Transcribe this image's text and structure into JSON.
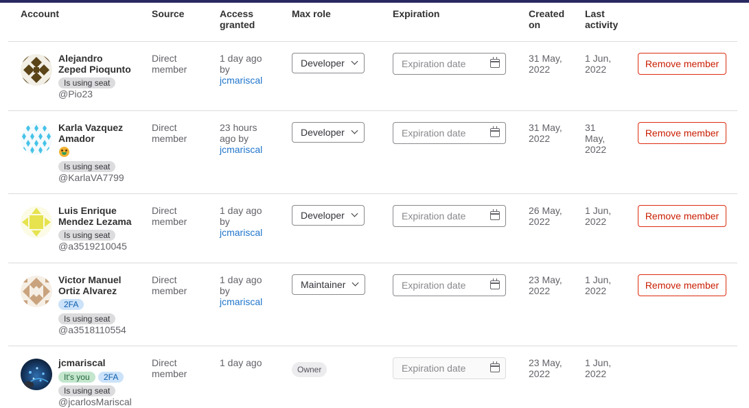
{
  "headers": {
    "account": "Account",
    "source": "Source",
    "access_line1": "Access",
    "access_line2": "granted",
    "max_role": "Max role",
    "expiration": "Expiration",
    "created_line1": "Created",
    "created_line2": "on",
    "activity_line1": "Last",
    "activity_line2": "activity"
  },
  "members": [
    {
      "name_line1": "Alejandro",
      "name_line2": "Zeped Pioqunto",
      "seat_badge": "Is using seat",
      "username": "@Pio23",
      "source_line1": "Direct",
      "source_line2": "member",
      "access_line1": "1 day ago",
      "access_line2": "by",
      "access_by": "jcmariscal",
      "role": "Developer",
      "expiration_placeholder": "Expiration date",
      "created_line1": "31 May,",
      "created_line2": "2022",
      "activity_line1": "1 Jun,",
      "activity_line2": "2022",
      "remove_label": "Remove member"
    },
    {
      "name_line1": "Karla Vazquez",
      "name_line2": "Amador",
      "seat_badge": "Is using seat",
      "username": "@KarlaVA7799",
      "source_line1": "Direct",
      "source_line2": "member",
      "access_line1": "23 hours",
      "access_line2": "ago by",
      "access_by": "jcmariscal",
      "role": "Developer",
      "expiration_placeholder": "Expiration date",
      "created_line1": "31 May,",
      "created_line2": "2022",
      "activity_line1": "31",
      "activity_line2": "May,",
      "activity_line3": "2022",
      "remove_label": "Remove member"
    },
    {
      "name_line1": "Luis Enrique",
      "name_line2": "Mendez Lezama",
      "seat_badge": "Is using seat",
      "username": "@a3519210045",
      "source_line1": "Direct",
      "source_line2": "member",
      "access_line1": "1 day ago",
      "access_line2": "by",
      "access_by": "jcmariscal",
      "role": "Developer",
      "expiration_placeholder": "Expiration date",
      "created_line1": "26 May,",
      "created_line2": "2022",
      "activity_line1": "1 Jun,",
      "activity_line2": "2022",
      "remove_label": "Remove member"
    },
    {
      "name_line1": "Victor Manuel",
      "name_line2": "Ortiz Alvarez",
      "twofa_badge": "2FA",
      "seat_badge": "Is using seat",
      "username": "@a3518110554",
      "source_line1": "Direct",
      "source_line2": "member",
      "access_line1": "1 day ago",
      "access_line2": "by",
      "access_by": "jcmariscal",
      "role": "Maintainer",
      "expiration_placeholder": "Expiration date",
      "created_line1": "23 May,",
      "created_line2": "2022",
      "activity_line1": "1 Jun,",
      "activity_line2": "2022",
      "remove_label": "Remove member"
    },
    {
      "name_line1": "jcmariscal",
      "you_badge": "It's you",
      "twofa_badge": "2FA",
      "seat_badge": "Is using seat",
      "username": "@jcarlosMariscal",
      "source_line1": "Direct",
      "source_line2": "member",
      "access_line1": "1 day ago",
      "role": "Owner",
      "expiration_placeholder": "Expiration date",
      "created_line1": "23 May,",
      "created_line2": "2022",
      "activity_line1": "1 Jun,",
      "activity_line2": "2022"
    }
  ]
}
